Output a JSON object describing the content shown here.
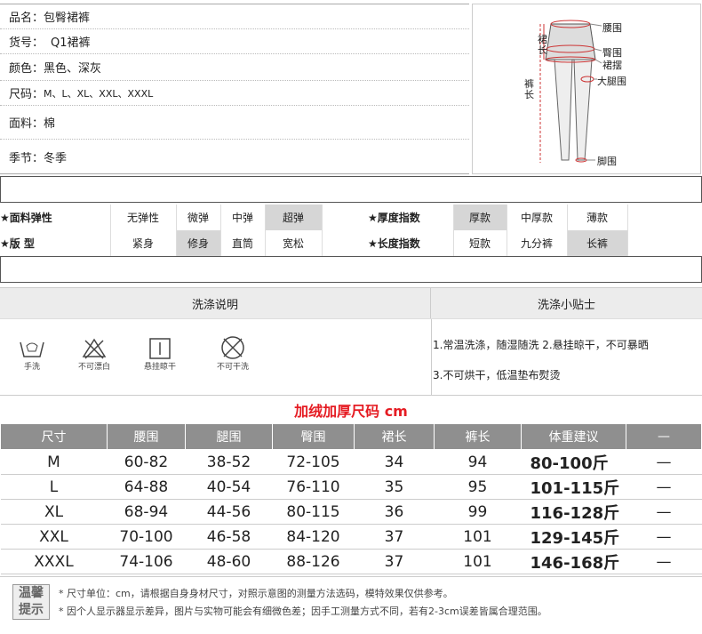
{
  "product": {
    "name_label": "品名：",
    "name": "包臀裙裤",
    "code_label": "货号：",
    "code": "Q1裙裤",
    "color_label": "颜色：",
    "color": "黑色、深灰",
    "size_label": "尺码：",
    "size": "M、L、XL、XXL、XXXL",
    "fabric_label": "面料：",
    "fabric": "棉",
    "season_label": "季节：",
    "season": "冬季"
  },
  "diagram": {
    "labels": [
      "腰围",
      "臀围",
      "裙摆",
      "大腿围",
      "脚围"
    ],
    "skirt_length": "裙长",
    "pant_length": "裤长"
  },
  "attributes": {
    "elasticity": {
      "title": "★面料弹性",
      "options": [
        "无弹性",
        "微弹",
        "中弹",
        "超弹"
      ],
      "selected": 3
    },
    "fit": {
      "title": "★版 型",
      "options": [
        "紧身",
        "修身",
        "直筒",
        "宽松"
      ],
      "selected": 1
    },
    "thickness": {
      "title": "★厚度指数",
      "options": [
        "厚款",
        "中厚款",
        "薄款"
      ],
      "selected": 0
    },
    "length": {
      "title": "★长度指数",
      "options": [
        "短款",
        "九分裤",
        "长裤"
      ],
      "selected": 2
    }
  },
  "washing": {
    "instructions_title": "洗涤说明",
    "tips_title": "洗涤小贴士",
    "icons": [
      {
        "icon": "hand-wash-icon",
        "label": "手洗"
      },
      {
        "icon": "no-bleach-icon",
        "label": "不可漂白"
      },
      {
        "icon": "hang-dry-icon",
        "label": "悬挂晾干"
      },
      {
        "icon": "no-tumble-dry-icon",
        "label": "不可干洗"
      }
    ],
    "tip1": "1.常温洗涤，随湿随洗 2.悬挂晾干，不可暴晒",
    "tip2": "3.不可烘干，低温垫布熨烫"
  },
  "size_chart": {
    "title": "加绒加厚尺码 cm",
    "headers": [
      "尺寸",
      "腰围",
      "腿围",
      "臀围",
      "裙长",
      "裤长",
      "体重建议",
      "—"
    ],
    "rows": [
      [
        "M",
        "60-82",
        "38-52",
        "72-105",
        "34",
        "94",
        "80-100斤",
        "—"
      ],
      [
        "L",
        "64-88",
        "40-54",
        "76-110",
        "35",
        "95",
        "101-115斤",
        "—"
      ],
      [
        "XL",
        "68-94",
        "44-56",
        "80-115",
        "36",
        "99",
        "116-128斤",
        "—"
      ],
      [
        "XXL",
        "70-100",
        "46-58",
        "84-120",
        "37",
        "101",
        "129-145斤",
        "—"
      ],
      [
        "XXXL",
        "74-106",
        "48-60",
        "88-126",
        "37",
        "101",
        "146-168斤",
        "—"
      ]
    ]
  },
  "tips": {
    "badge_top": "温馨",
    "badge_bottom": "提示",
    "line1": "* 尺寸单位：cm，请根据自身身材尺寸，对照示意图的测量方法选码，模特效果仅供参考。",
    "line2": "* 因个人显示器显示差异，图片与实物可能会有细微色差；因手工测量方式不同，若有2-3cm误差皆属合理范围。"
  }
}
